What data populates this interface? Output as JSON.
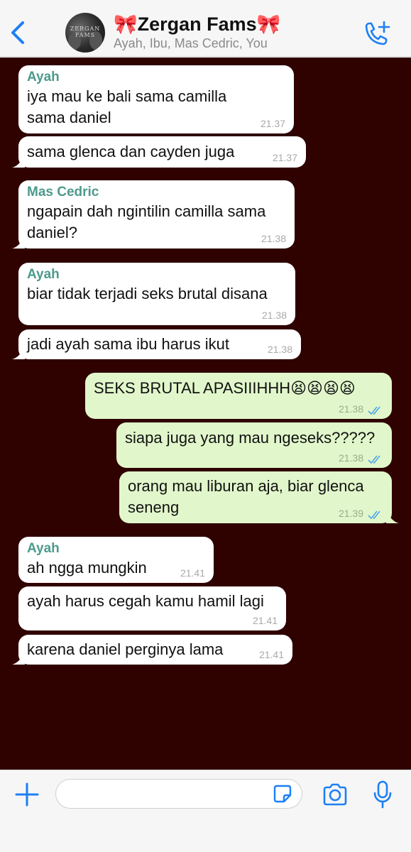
{
  "header": {
    "title": "🎀Zergan Fams🎀",
    "subtitle": "Ayah, Ibu, Mas Cedric, You",
    "avatar_text": "ZERGAN FAMS"
  },
  "colors": {
    "chat_background": "#2f0200",
    "incoming_bubble": "#ffffff",
    "outgoing_bubble": "#e1f7cb",
    "sender_name": "#4d9a8d",
    "accent": "#1d7ff5",
    "read_ticks": "#4fa6e8"
  },
  "messages": [
    {
      "sender": "Ayah",
      "text": "iya mau ke bali sama camilla sama daniel",
      "time": "21.37",
      "direction": "in"
    },
    {
      "sender": "",
      "text": "sama glenca dan cayden juga",
      "time": "21.37",
      "direction": "in"
    },
    {
      "sender": "Mas Cedric",
      "text": "ngapain dah ngintilin camilla sama daniel?",
      "time": "21.38",
      "direction": "in"
    },
    {
      "sender": "Ayah",
      "text": "biar tidak terjadi seks brutal disana",
      "time": "21.38",
      "direction": "in"
    },
    {
      "sender": "",
      "text": "jadi ayah sama ibu harus ikut",
      "time": "21.38",
      "direction": "in"
    },
    {
      "sender": "",
      "text": "SEKS BRUTAL APASIIIHHH😫😫😫😫",
      "time": "21.38",
      "direction": "out",
      "status": "read"
    },
    {
      "sender": "",
      "text": "siapa juga yang mau ngeseks?????",
      "time": "21.38",
      "direction": "out",
      "status": "read"
    },
    {
      "sender": "",
      "text": "orang mau liburan aja, biar glenca seneng",
      "time": "21.39",
      "direction": "out",
      "status": "read"
    },
    {
      "sender": "Ayah",
      "text": "ah ngga mungkin",
      "time": "21.41",
      "direction": "in"
    },
    {
      "sender": "",
      "text": "ayah harus cegah kamu hamil lagi",
      "time": "21.41",
      "direction": "in"
    },
    {
      "sender": "",
      "text": "karena daniel perginya lama",
      "time": "21.41",
      "direction": "in"
    }
  ],
  "composer": {
    "value": "",
    "placeholder": ""
  },
  "icons": {
    "back": "chevron-left-icon",
    "call": "add-call-icon",
    "attach": "plus-icon",
    "sticker": "sticker-icon",
    "camera": "camera-icon",
    "mic": "microphone-icon"
  }
}
